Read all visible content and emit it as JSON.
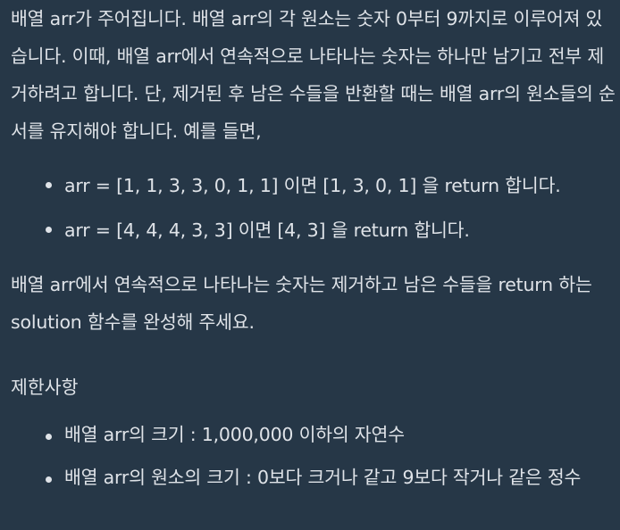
{
  "problem": {
    "intro": "배열 arr가 주어집니다. 배열 arr의 각 원소는 숫자 0부터 9까지로 이루어져 있습니다. 이때, 배열 arr에서 연속적으로 나타나는 숫자는 하나만 남기고 전부 제거하려고 합니다. 단, 제거된 후 남은 수들을 반환할 때는 배열 arr의 원소들의 순서를 유지해야 합니다. 예를 들면,",
    "examples": [
      "arr = [1, 1, 3, 3, 0, 1, 1] 이면 [1, 3, 0, 1] 을 return 합니다.",
      "arr = [4, 4, 4, 3, 3] 이면 [4, 3] 을 return 합니다."
    ],
    "outro": "배열 arr에서 연속적으로 나타나는 숫자는 제거하고 남은 수들을 return 하는 solution 함수를 완성해 주세요.",
    "constraints_heading": "제한사항",
    "constraints": [
      "배열 arr의 크기 : 1,000,000 이하의 자연수",
      "배열 arr의 원소의 크기 : 0보다 크거나 같고 9보다 작거나 같은 정수"
    ]
  }
}
